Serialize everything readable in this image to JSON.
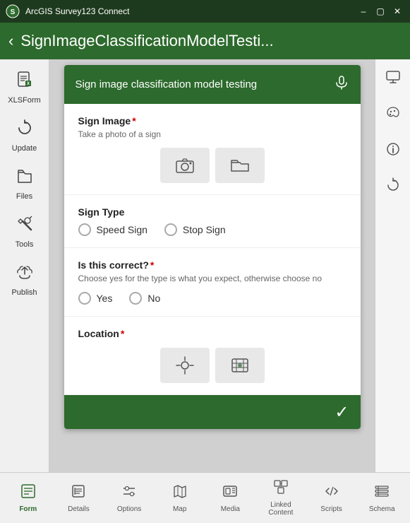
{
  "titleBar": {
    "appName": "ArcGIS Survey123 Connect",
    "minBtn": "–",
    "maxBtn": "▢",
    "closeBtn": "✕"
  },
  "navBar": {
    "backBtn": "‹",
    "title": "SignImageClassificationModelTesti..."
  },
  "sidebar": {
    "items": [
      {
        "id": "xlsform",
        "label": "XLSForm",
        "icon": "📄"
      },
      {
        "id": "update",
        "label": "Update",
        "icon": "🔄"
      },
      {
        "id": "files",
        "label": "Files",
        "icon": "📁"
      },
      {
        "id": "tools",
        "label": "Tools",
        "icon": "🔧"
      },
      {
        "id": "publish",
        "label": "Publish",
        "icon": "☁"
      }
    ]
  },
  "rightPanel": {
    "icons": [
      "🖥",
      "🎨",
      "ℹ",
      "↺"
    ]
  },
  "survey": {
    "header": "Sign image classification model testing",
    "headerIcon": "🎤",
    "sections": [
      {
        "id": "sign-image",
        "label": "Sign Image",
        "required": true,
        "hint": "Take a photo of a sign",
        "type": "image"
      },
      {
        "id": "sign-type",
        "label": "Sign Type",
        "required": false,
        "type": "radio",
        "options": [
          "Speed Sign",
          "Stop Sign"
        ]
      },
      {
        "id": "is-correct",
        "label": "Is this correct?",
        "required": true,
        "hint": "Choose yes for the type is what you expect, otherwise choose no",
        "type": "radio",
        "options": [
          "Yes",
          "No"
        ]
      },
      {
        "id": "location",
        "label": "Location",
        "required": true,
        "type": "location"
      }
    ],
    "checkmark": "✓"
  },
  "bottomTabs": {
    "items": [
      {
        "id": "form",
        "label": "Form",
        "icon": "form",
        "active": true
      },
      {
        "id": "details",
        "label": "Details",
        "icon": "details"
      },
      {
        "id": "options",
        "label": "Options",
        "icon": "options"
      },
      {
        "id": "map",
        "label": "Map",
        "icon": "map"
      },
      {
        "id": "media",
        "label": "Media",
        "icon": "media"
      },
      {
        "id": "linked-content",
        "label": "Linked Content",
        "icon": "linked"
      },
      {
        "id": "scripts",
        "label": "Scripts",
        "icon": "scripts"
      },
      {
        "id": "schema",
        "label": "Schema",
        "icon": "schema"
      }
    ]
  }
}
